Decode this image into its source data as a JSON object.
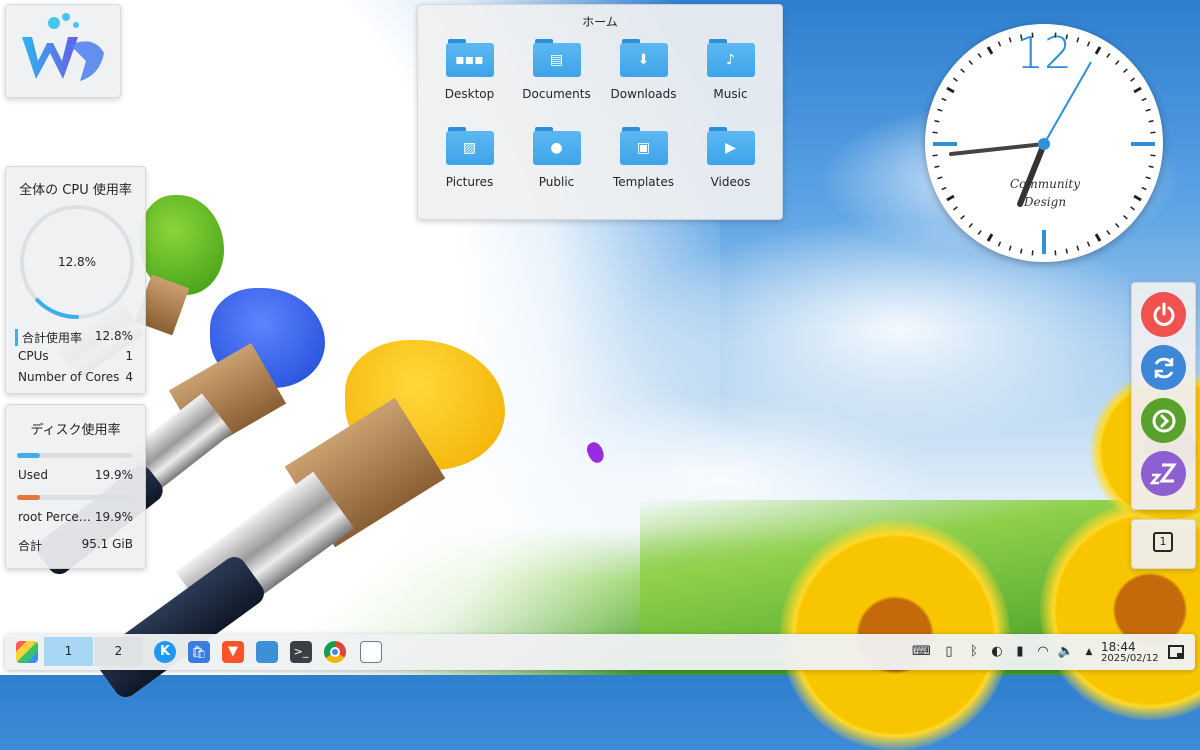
{
  "folder_view": {
    "title": "ホーム",
    "items": [
      {
        "label": "Desktop",
        "icon": "desktop-folder-icon",
        "glyph": "▪▪▪"
      },
      {
        "label": "Documents",
        "icon": "documents-folder-icon",
        "glyph": "▤"
      },
      {
        "label": "Downloads",
        "icon": "downloads-folder-icon",
        "glyph": "⬇"
      },
      {
        "label": "Music",
        "icon": "music-folder-icon",
        "glyph": "♪"
      },
      {
        "label": "Pictures",
        "icon": "pictures-folder-icon",
        "glyph": "▨"
      },
      {
        "label": "Public",
        "icon": "public-folder-icon",
        "glyph": "●"
      },
      {
        "label": "Templates",
        "icon": "templates-folder-icon",
        "glyph": "▣"
      },
      {
        "label": "Videos",
        "icon": "videos-folder-icon",
        "glyph": "▶"
      }
    ]
  },
  "cpu_widget": {
    "title": "全体の CPU 使用率",
    "gauge_value": "12.8%",
    "gauge_fraction": 0.128,
    "rows": [
      {
        "label": "合計使用率",
        "value": "12.8%"
      },
      {
        "label": "CPUs",
        "value": "1"
      },
      {
        "label": "Number of Cores",
        "value": "4"
      }
    ]
  },
  "disk_widget": {
    "title": "ディスク使用率",
    "rows": [
      {
        "label": "Used",
        "value": "19.9%",
        "fraction": 0.199,
        "color": "#3daee9"
      },
      {
        "label": "root Percentage",
        "value": "19.9%",
        "fraction": 0.199,
        "color": "#e8743b"
      }
    ],
    "total": {
      "label": "合計",
      "value": "95.1 GiB"
    }
  },
  "clock_widget": {
    "numeral": "12",
    "brand_line1": "Community",
    "brand_line2": "Design",
    "accent": "#2f8fd8"
  },
  "session_buttons": [
    {
      "name": "shutdown",
      "icon": "power-icon",
      "color": "#f0524f"
    },
    {
      "name": "restart",
      "icon": "restart-icon",
      "color": "#3d86d8"
    },
    {
      "name": "logout",
      "icon": "logout-icon",
      "color": "#5aa02c"
    },
    {
      "name": "sleep",
      "icon": "sleep-icon",
      "color": "#8e5fd0"
    }
  ],
  "notifications": {
    "count": "1"
  },
  "taskbar": {
    "pager": [
      "1",
      "2"
    ],
    "time": "18:44",
    "date": "2025/02/12"
  }
}
